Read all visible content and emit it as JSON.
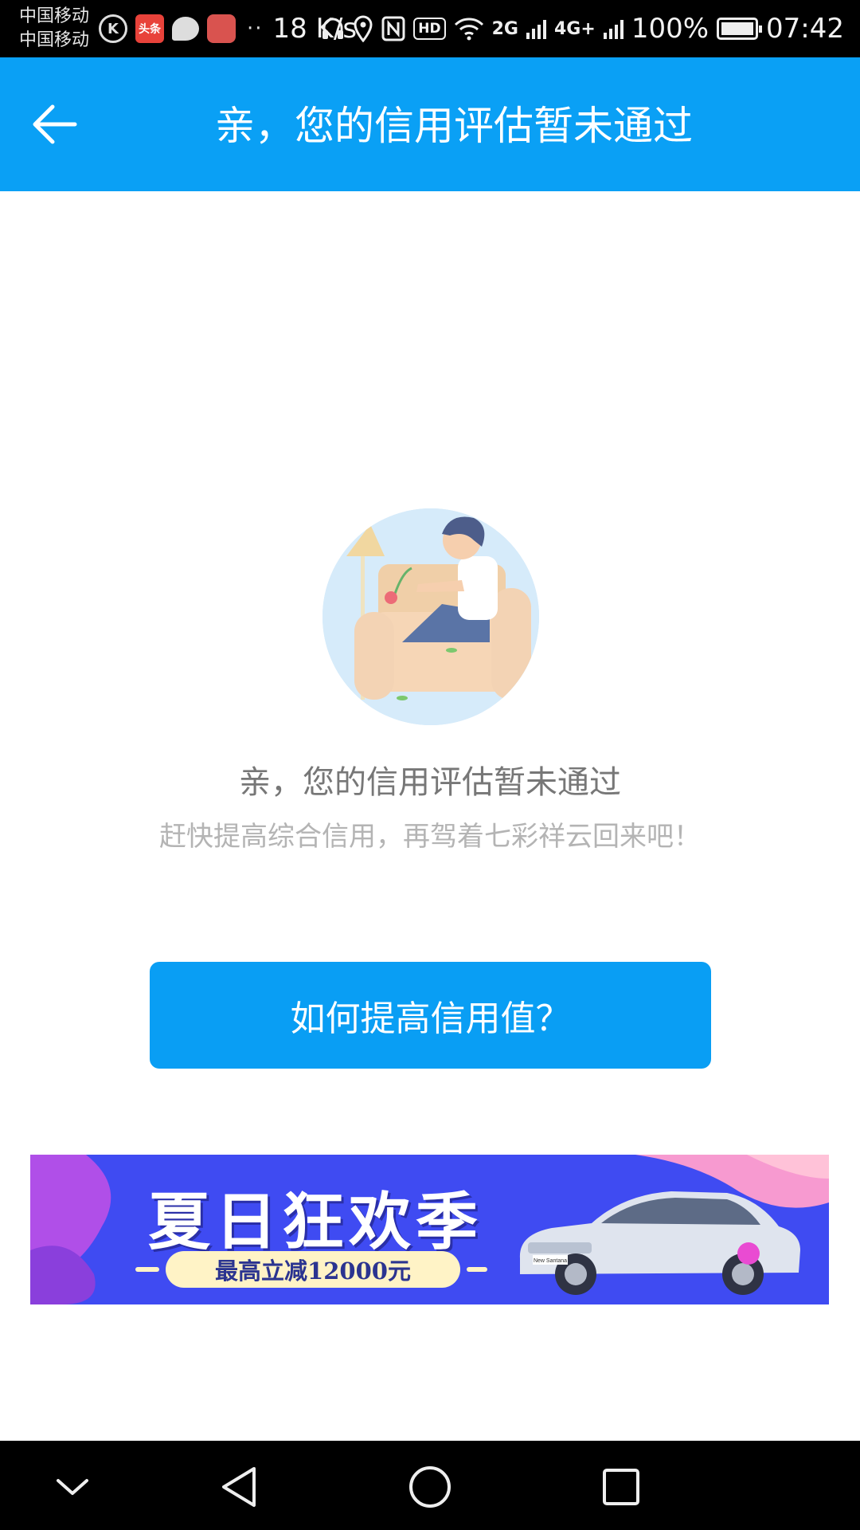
{
  "status_bar": {
    "carrier_1": "中国移动",
    "carrier_2": "中国移动",
    "app_icon_toutiao": "头条",
    "overflow": "··",
    "net_speed": "18 K/s",
    "signal_1_label": "2G",
    "signal_2_label": "4G+",
    "hd_label": "HD",
    "battery": "100%",
    "battery_level": 1.0,
    "time": "07:42"
  },
  "header": {
    "title": "亲，您的信用评估暂未通过"
  },
  "message": {
    "title": "亲，您的信用评估暂未通过",
    "subtitle": "赶快提高综合信用，再驾着七彩祥云回来吧！"
  },
  "cta": {
    "label": "如何提高信用值？"
  },
  "banner": {
    "headline": "夏日狂欢季",
    "subline": "最高立减12000元",
    "car_plate": "New Santana"
  },
  "colors": {
    "primary": "#0aa0f5",
    "banner_bg": "#3f4bf2",
    "text_title": "#777777",
    "text_sub": "#b4b4b4"
  }
}
